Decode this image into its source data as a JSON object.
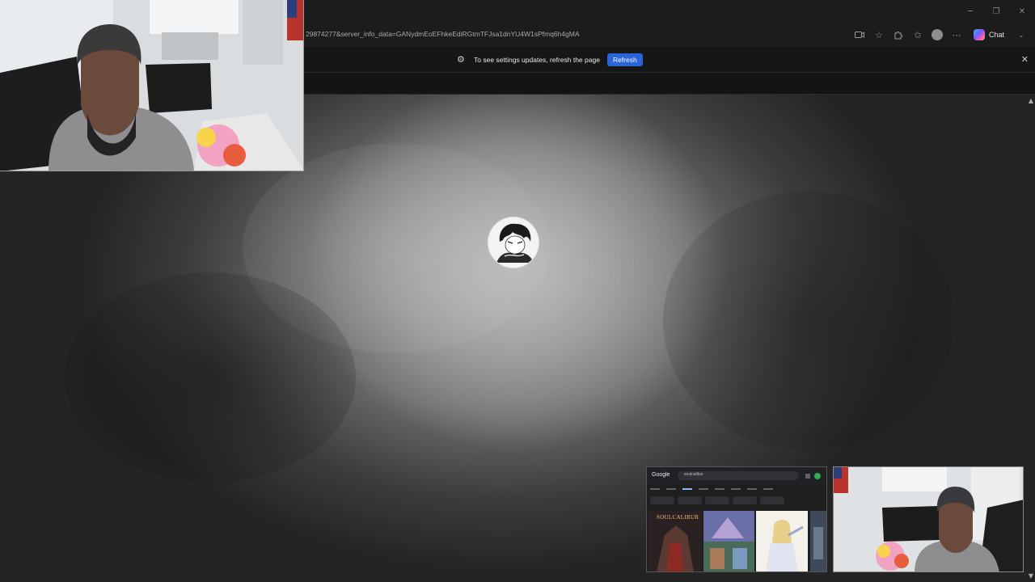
{
  "browser": {
    "url_fragment": "29874277&server_info_data=GANydmEoEFhkeEdiRGtmTFJsa1dnYU4W1sPfmq6h4gMA",
    "chat_label": "Chat",
    "window_controls": {
      "minimize": "─",
      "restore": "❐",
      "close": "✕"
    }
  },
  "infobar": {
    "message": "To see settings updates, refresh the page",
    "refresh_label": "Refresh",
    "close_glyph": "✕"
  },
  "thumbnail_google": {
    "logo_text": "Google",
    "search_value": "soulcalibur",
    "result_title": "SOULCALIBUR"
  },
  "colors": {
    "accent_button": "#2b63d9",
    "chrome_bg": "#1c1c1c",
    "infobar_bg": "#161616"
  },
  "icons": {
    "camera": "camera-icon",
    "favorite": "star-icon",
    "extensions": "extensions-icon",
    "collections": "collections-icon",
    "profile": "profile-icon",
    "more": "more-icon",
    "copilot": "copilot-icon",
    "settings": "gear-icon"
  }
}
